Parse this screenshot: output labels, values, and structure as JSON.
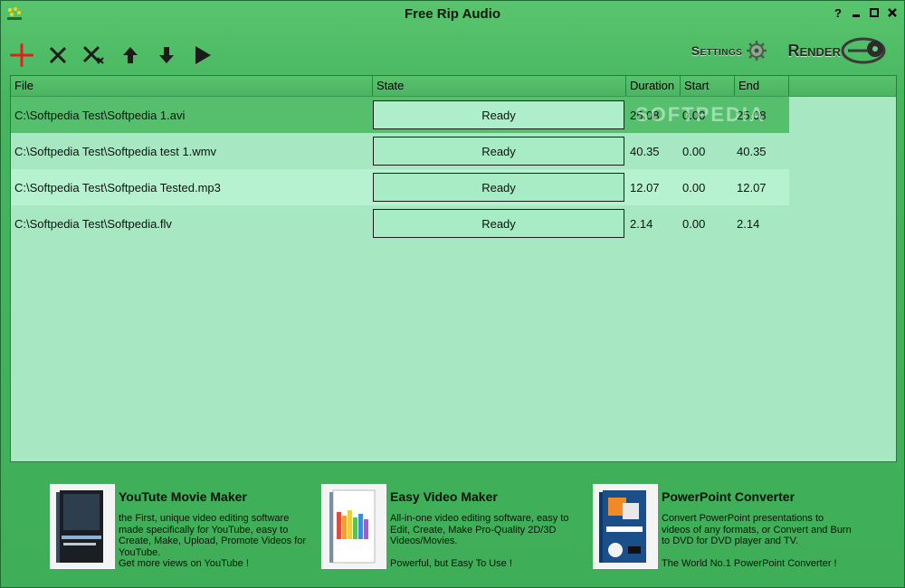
{
  "window": {
    "title": "Free Rip Audio",
    "controls": {
      "help": "?",
      "minimize": "▬",
      "maximize": "□",
      "close": "✕"
    }
  },
  "toolbar": {
    "add_icon": "plus-icon",
    "remove_icon": "x-icon",
    "remove_all_icon": "x-all-icon",
    "move_up_icon": "arrow-up-icon",
    "move_down_icon": "arrow-down-icon",
    "play_icon": "play-icon",
    "settings_label": "Settings",
    "render_label": "Render"
  },
  "list": {
    "columns": [
      "File",
      "State",
      "Duration",
      "Start",
      "End"
    ],
    "rows": [
      {
        "file": "C:\\Softpedia Test\\Softpedia 1.avi",
        "state": "Ready",
        "duration": "25.08",
        "start": "0.00",
        "end": "25.08"
      },
      {
        "file": "C:\\Softpedia Test\\Softpedia test 1.wmv",
        "state": "Ready",
        "duration": "40.35",
        "start": "0.00",
        "end": "40.35"
      },
      {
        "file": "C:\\Softpedia Test\\Softpedia Tested.mp3",
        "state": "Ready",
        "duration": "12.07",
        "start": "0.00",
        "end": "12.07"
      },
      {
        "file": "C:\\Softpedia Test\\Softpedia.flv",
        "state": "Ready",
        "duration": "2.14",
        "start": "0.00",
        "end": "2.14"
      }
    ],
    "watermark": "SOFTPEDIA"
  },
  "ads": [
    {
      "title": "YouTute Movie Maker",
      "desc": "the First, unique video editing software made specifically for YouTube, easy to Create, Make, Upload, Promote Videos for YouTube.\nGet more views on YouTube !"
    },
    {
      "title": "Easy Video Maker",
      "desc": "All-in-one video editing software, easy to Edit, Create, Make Pro-Quality 2D/3D Videos/Movies.\n\nPowerful, but Easy To Use !"
    },
    {
      "title": "PowerPoint Converter",
      "desc": "Convert PowerPoint presentations to videos of any formats, or Convert and Burn to DVD for DVD player and TV.\n\nThe World No.1 PowerPoint Converter !"
    }
  ],
  "colors": {
    "window_bg": "#45b45e",
    "list_bg": "#a7e8c3",
    "selected_row": "#55bf6e",
    "accent_add": "#e02020"
  }
}
